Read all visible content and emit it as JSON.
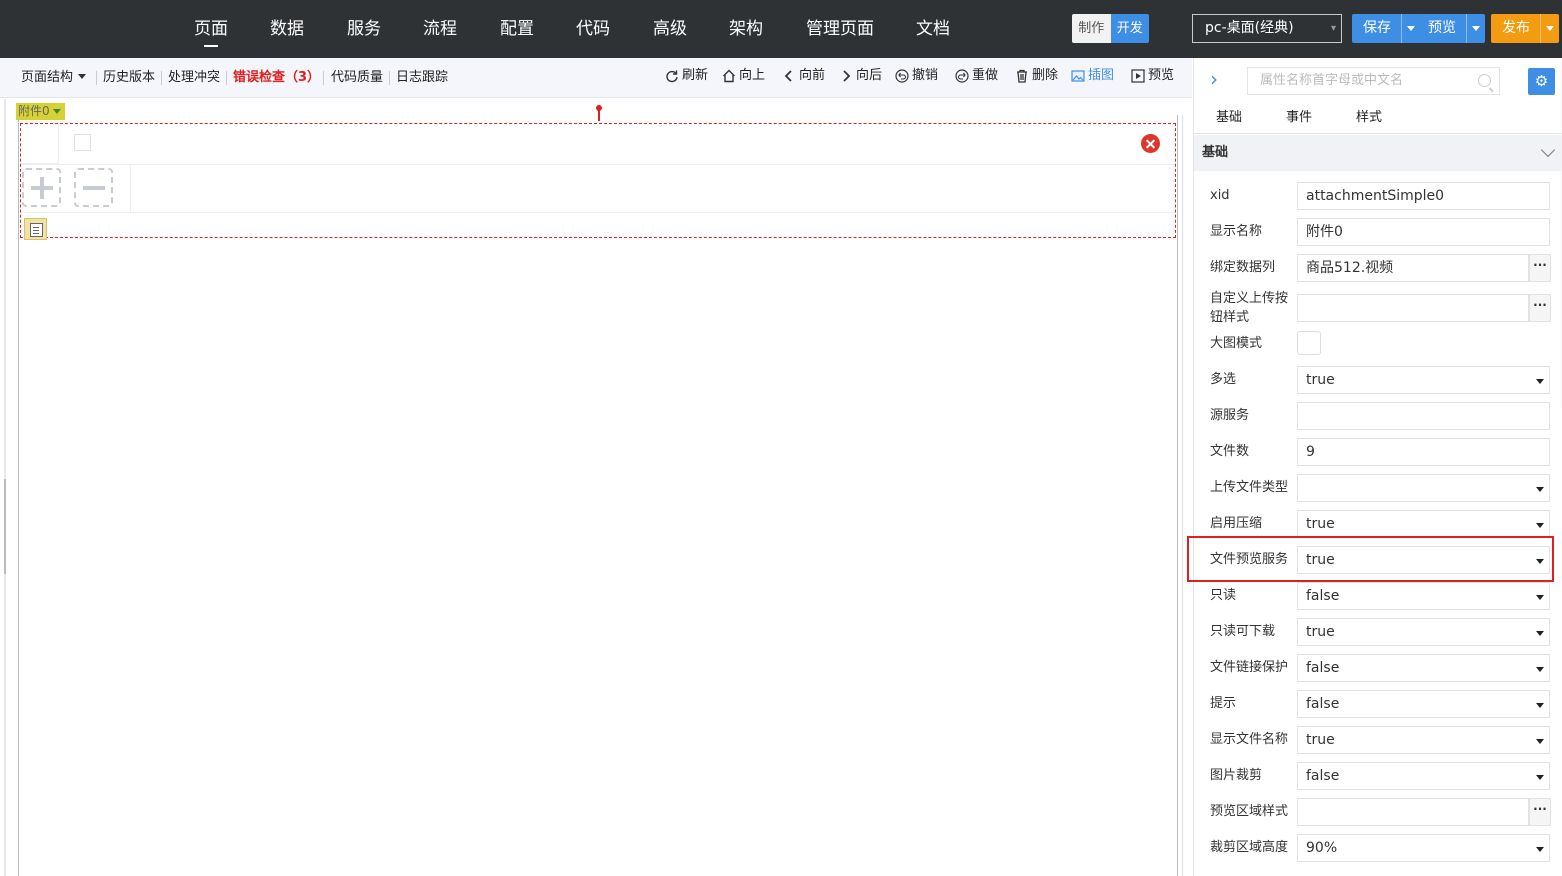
{
  "top_nav": {
    "items": [
      {
        "label": "页面",
        "active": true
      },
      {
        "label": "数据"
      },
      {
        "label": "服务"
      },
      {
        "label": "流程"
      },
      {
        "label": "配置"
      },
      {
        "label": "代码"
      },
      {
        "label": "高级"
      },
      {
        "label": "架构"
      },
      {
        "label": "管理页面"
      },
      {
        "label": "文档"
      }
    ],
    "mode_make": "制作",
    "mode_dev": "开发",
    "device": "pc-桌面(经典)",
    "save": "保存",
    "preview": "预览",
    "publish": "发布"
  },
  "toolbar": {
    "page_structure": "页面结构",
    "history": "历史版本",
    "conflict": "处理冲突",
    "error_check": "错误检查（3）",
    "code_quality": "代码质量",
    "log_trace": "日志跟踪",
    "actions": [
      {
        "label": "刷新",
        "icon": "refresh-icon"
      },
      {
        "label": "向上",
        "icon": "home-icon"
      },
      {
        "label": "向前",
        "icon": "chevron-left-icon"
      },
      {
        "label": "向后",
        "icon": "chevron-right-icon"
      },
      {
        "label": "撤销",
        "icon": "undo-icon"
      },
      {
        "label": "重做",
        "icon": "redo-icon"
      },
      {
        "label": "删除",
        "icon": "trash-icon"
      },
      {
        "label": "插图",
        "icon": "image-icon",
        "active": true
      },
      {
        "label": "预览",
        "icon": "play-icon"
      }
    ]
  },
  "canvas": {
    "component_tag": "附件0"
  },
  "right_panel": {
    "search_placeholder": "属性名称首字母或中文名",
    "tabs": [
      "基础",
      "事件",
      "样式"
    ],
    "section": "基础",
    "props": [
      {
        "label": "xid",
        "value": "attachmentSimple0",
        "type": "text"
      },
      {
        "label": "显示名称",
        "value": "附件0",
        "type": "text"
      },
      {
        "label": "绑定数据列",
        "value": "商品512.视频",
        "type": "dots"
      },
      {
        "label": "自定义上传按钮样式",
        "value": "",
        "type": "dots"
      },
      {
        "label": "大图模式",
        "value": "",
        "type": "checkbox"
      },
      {
        "label": "多选",
        "value": "true",
        "type": "select"
      },
      {
        "label": "源服务",
        "value": "",
        "type": "text"
      },
      {
        "label": "文件数",
        "value": "9",
        "type": "text"
      },
      {
        "label": "上传文件类型",
        "value": "",
        "type": "select"
      },
      {
        "label": "启用压缩",
        "value": "true",
        "type": "select"
      },
      {
        "label": "文件预览服务",
        "value": "true",
        "type": "select",
        "highlighted": true
      },
      {
        "label": "只读",
        "value": "false",
        "type": "select"
      },
      {
        "label": "只读可下载",
        "value": "true",
        "type": "select"
      },
      {
        "label": "文件链接保护",
        "value": "false",
        "type": "select"
      },
      {
        "label": "提示",
        "value": "false",
        "type": "select"
      },
      {
        "label": "显示文件名称",
        "value": "true",
        "type": "select"
      },
      {
        "label": "图片裁剪",
        "value": "false",
        "type": "select"
      },
      {
        "label": "预览区域样式",
        "value": "",
        "type": "dots"
      },
      {
        "label": "裁剪区域高度",
        "value": "90%",
        "type": "select"
      }
    ]
  },
  "colors": {
    "nav_bg": "#2f3235",
    "accent_blue": "#3f8ee5",
    "publish_orange": "#f39c12",
    "error_red": "#e02020"
  }
}
